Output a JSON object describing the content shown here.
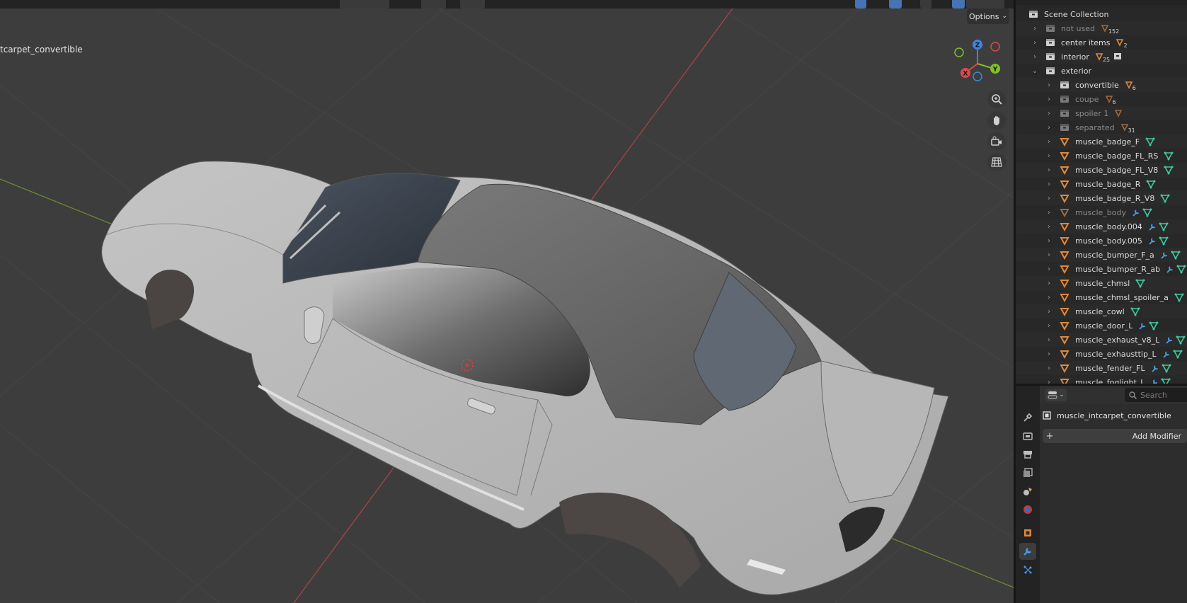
{
  "viewport": {
    "object_name": "tcarpet_convertible",
    "options_label": "Options",
    "gizmo": {
      "x_label": "X",
      "y_label": "Y",
      "z_label": "Z"
    },
    "nav_icons": [
      "zoom-icon",
      "hand-icon",
      "camera-icon",
      "grid-icon"
    ]
  },
  "outliner": {
    "rows": [
      {
        "label": "Scene Collection",
        "type": "scene",
        "depth": 0,
        "expander": ""
      },
      {
        "label": "not used",
        "type": "collection",
        "depth": 1,
        "expander": "right",
        "dim": true,
        "count": "152"
      },
      {
        "label": "center items",
        "type": "collection",
        "depth": 1,
        "expander": "right",
        "count": "2"
      },
      {
        "label": "interior",
        "type": "collection",
        "depth": 1,
        "expander": "right",
        "count": "25"
      },
      {
        "label": "exterior",
        "type": "collection",
        "depth": 1,
        "expander": "down"
      },
      {
        "label": "convertible",
        "type": "collection",
        "depth": 2,
        "expander": "right",
        "count": "6"
      },
      {
        "label": "coupe",
        "type": "collection",
        "depth": 2,
        "expander": "right",
        "dim": true,
        "count": "6"
      },
      {
        "label": "spoiler 1",
        "type": "collection",
        "depth": 2,
        "expander": "right",
        "dim": true
      },
      {
        "label": "separated",
        "type": "collection",
        "depth": 2,
        "expander": "right",
        "dim": true,
        "count": "31"
      },
      {
        "label": "muscle_badge_F",
        "type": "mesh",
        "depth": 2,
        "expander": "right"
      },
      {
        "label": "muscle_badge_FL_RS",
        "type": "mesh",
        "depth": 2,
        "expander": "right"
      },
      {
        "label": "muscle_badge_FL_V8",
        "type": "mesh",
        "depth": 2,
        "expander": "right"
      },
      {
        "label": "muscle_badge_R",
        "type": "mesh",
        "depth": 2,
        "expander": "right"
      },
      {
        "label": "muscle_badge_R_V8",
        "type": "mesh",
        "depth": 2,
        "expander": "right"
      },
      {
        "label": "muscle_body",
        "type": "mesh",
        "depth": 2,
        "expander": "right",
        "dim": true,
        "modifier": true
      },
      {
        "label": "muscle_body.004",
        "type": "mesh",
        "depth": 2,
        "expander": "right",
        "modifier": true
      },
      {
        "label": "muscle_body.005",
        "type": "mesh",
        "depth": 2,
        "expander": "right",
        "modifier": true
      },
      {
        "label": "muscle_bumper_F_a",
        "type": "mesh",
        "depth": 2,
        "expander": "right",
        "modifier": true
      },
      {
        "label": "muscle_bumper_R_ab",
        "type": "mesh",
        "depth": 2,
        "expander": "right",
        "modifier": true
      },
      {
        "label": "muscle_chmsl",
        "type": "mesh",
        "depth": 2,
        "expander": "right"
      },
      {
        "label": "muscle_chmsl_spoiler_a",
        "type": "mesh",
        "depth": 2,
        "expander": "right"
      },
      {
        "label": "muscle_cowl",
        "type": "mesh",
        "depth": 2,
        "expander": "right"
      },
      {
        "label": "muscle_door_L",
        "type": "mesh",
        "depth": 2,
        "expander": "right",
        "modifier": true
      },
      {
        "label": "muscle_exhaust_v8_L",
        "type": "mesh",
        "depth": 2,
        "expander": "right",
        "modifier": true
      },
      {
        "label": "muscle_exhausttip_L",
        "type": "mesh",
        "depth": 2,
        "expander": "right",
        "modifier": true
      },
      {
        "label": "muscle_fender_FL",
        "type": "mesh",
        "depth": 2,
        "expander": "right",
        "modifier": true
      },
      {
        "label": "muscle_foglight_L",
        "type": "mesh",
        "depth": 2,
        "expander": "right",
        "modifier": true
      }
    ]
  },
  "properties": {
    "search_placeholder": "Search",
    "object_name": "muscle_intcarpet_convertible",
    "add_modifier_label": "Add Modifier",
    "tabs": [
      "tool-icon",
      "render-icon",
      "output-icon",
      "view-layer-icon",
      "scene-icon",
      "world-icon",
      "object-icon",
      "modifier-icon",
      "particles-icon"
    ],
    "active_tab": "modifier-icon"
  },
  "colors": {
    "accent": "#4772b3",
    "mesh_orange": "#e0883a",
    "data_green": "#3fc9a2",
    "axis_x": "#e04848",
    "axis_y": "#7fbf2a",
    "axis_z": "#3c86e0"
  }
}
